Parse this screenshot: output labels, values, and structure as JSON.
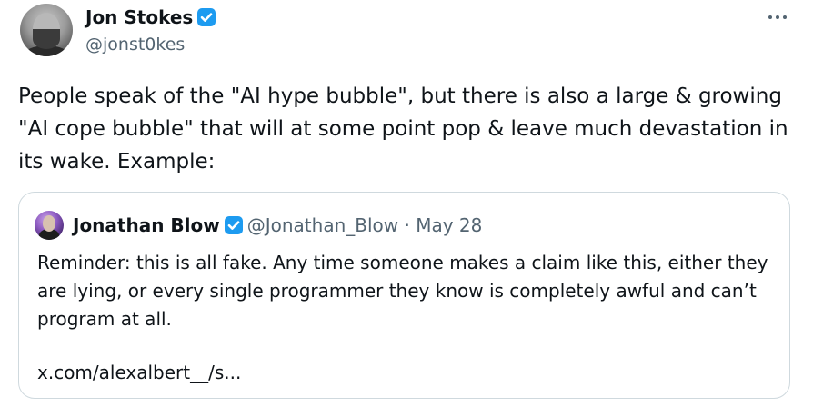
{
  "author": {
    "display_name": "Jon Stokes",
    "handle": "@jonst0kes",
    "verified_icon": "verified-badge-icon",
    "avatar_icon": "avatar"
  },
  "menu": {
    "more_icon": "more-options-icon"
  },
  "tweet": {
    "text": "People speak of the \"AI hype bubble\", but there is also a large & growing\n\"AI cope bubble\" that will at some point pop & leave much devastation in\nits wake. Example:"
  },
  "quoted_tweet": {
    "display_name": "Jonathan Blow",
    "handle": "@Jonathan_Blow",
    "separator": "·",
    "date": "May 28",
    "text": "Reminder: this is all fake. Any time someone makes a claim like this, either they\nare lying, or every single programmer they know is completely awful and can’t\nprogram at all.",
    "link": "x.com/alexalbert__/s..."
  },
  "colors": {
    "verified_blue": "#1d9bf0",
    "text_primary": "#0f1419",
    "text_secondary": "#536471",
    "border": "#cfd9de"
  }
}
